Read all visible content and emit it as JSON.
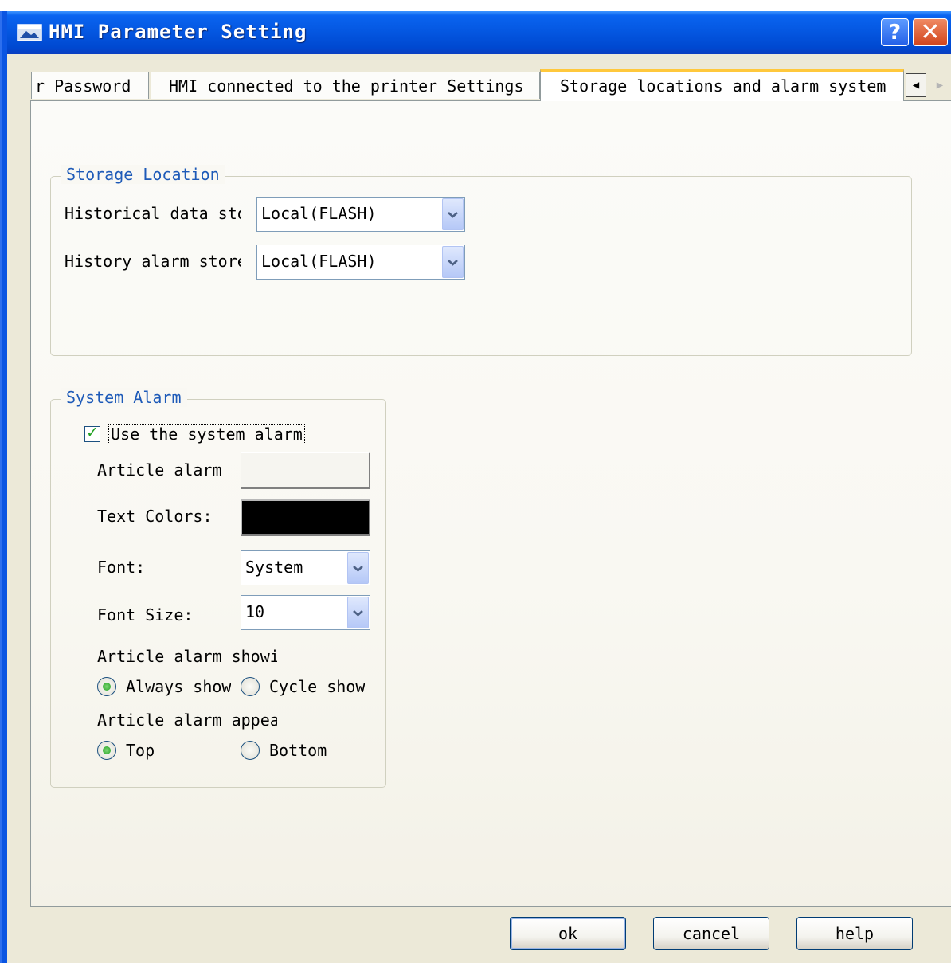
{
  "window": {
    "title": "HMI Parameter Setting",
    "help_symbol": "?",
    "close_symbol": "✕",
    "colors": {
      "titlebar": "#0456e0",
      "face": "#ece9d8",
      "active_tab_accent": "#ffc83c"
    }
  },
  "tabs": [
    {
      "label": "r Password",
      "selected": false
    },
    {
      "label": "HMI connected to the printer Settings",
      "selected": false
    },
    {
      "label": "Storage locations and alarm system",
      "selected": true
    }
  ],
  "tab_scroll": {
    "left": "◀",
    "right": "▶"
  },
  "storage": {
    "title": "Storage Location",
    "historical_label": "Historical data sto",
    "historical_value": "Local(FLASH)",
    "alarm_store_label": "History alarm store",
    "alarm_store_value": "Local(FLASH)"
  },
  "system_alarm": {
    "title": "System Alarm",
    "use_alarm_label": "Use the system alarm",
    "use_alarm_checked": true,
    "checkmark": "✓",
    "article_alarm_label": "Article alarm",
    "article_alarm_color": "#f6f5f0",
    "text_colors_label": "Text Colors:",
    "text_color": "#000000",
    "font_label": "Font:",
    "font_value": "System",
    "font_size_label": "Font Size:",
    "font_size_value": "10",
    "show_label": "Article alarm showi",
    "always_show": "Always show",
    "cycle_show": "Cycle show",
    "show_selected": "Always show",
    "appear_label": "Article alarm appea",
    "top": "Top",
    "bottom": "Bottom",
    "appear_selected": "Top"
  },
  "buttons": {
    "ok": "ok",
    "cancel": "cancel",
    "help": "help"
  }
}
